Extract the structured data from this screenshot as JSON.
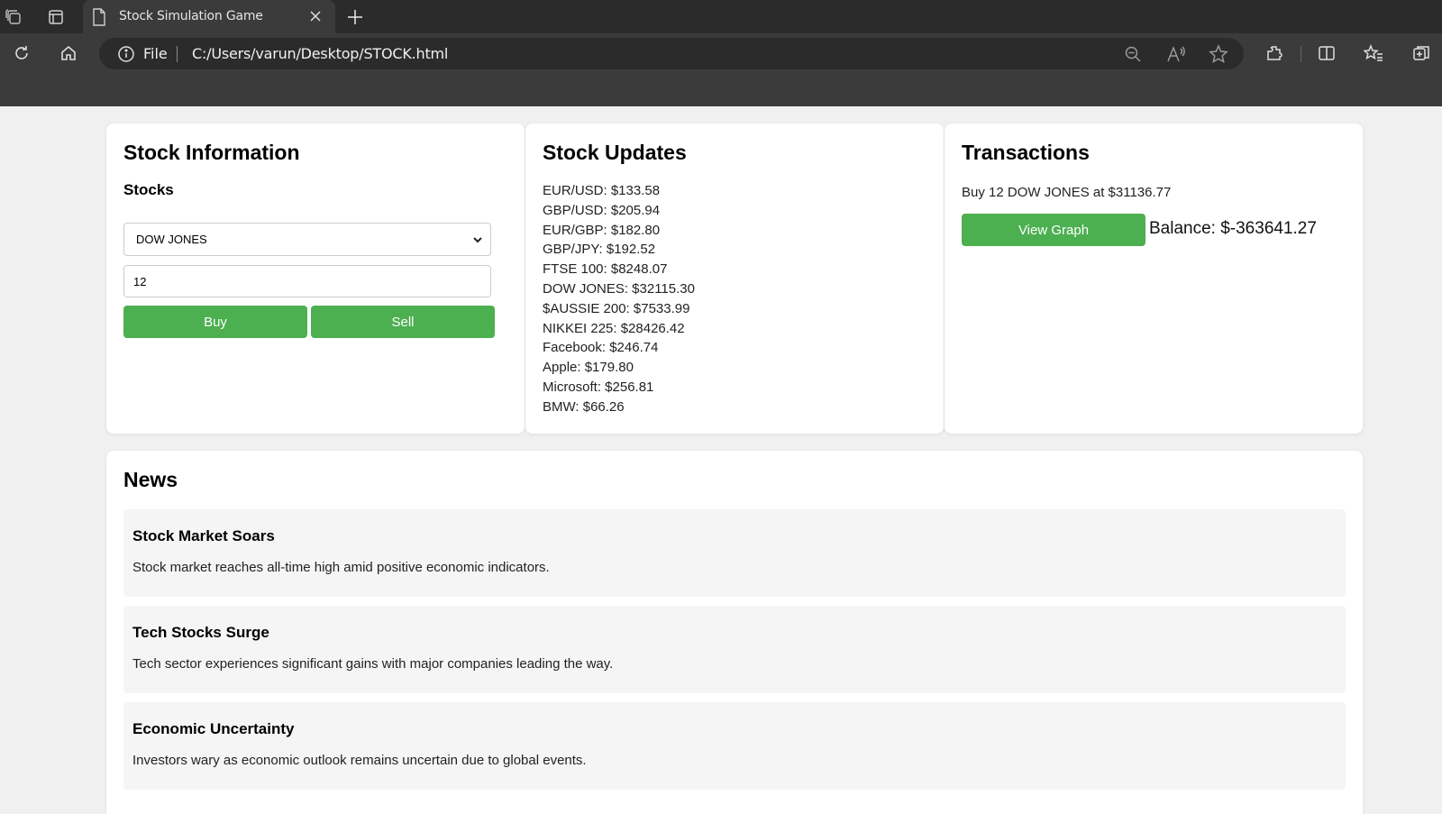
{
  "browser": {
    "tab_title": "Stock Simulation Game",
    "address_scheme": "File",
    "address_url": "C:/Users/varun/Desktop/STOCK.html"
  },
  "stock_info": {
    "title": "Stock Information",
    "stocks_label": "Stocks",
    "selected_stock": "DOW JONES",
    "quantity": "12",
    "buy_label": "Buy",
    "sell_label": "Sell"
  },
  "stock_updates": {
    "title": "Stock Updates",
    "rows": [
      "EUR/USD: $133.58",
      "GBP/USD: $205.94",
      "EUR/GBP: $182.80",
      "GBP/JPY: $192.52",
      "FTSE 100: $8248.07",
      "DOW JONES: $32115.30",
      "$AUSSIE 200: $7533.99",
      "NIKKEI 225: $28426.42",
      "Facebook: $246.74",
      "Apple: $179.80",
      "Microsoft: $256.81",
      "BMW: $66.26"
    ]
  },
  "transactions": {
    "title": "Transactions",
    "last": "Buy 12 DOW JONES at $31136.77",
    "view_graph_label": "View Graph",
    "balance": "Balance: $-363641.27"
  },
  "news": {
    "title": "News",
    "items": [
      {
        "title": "Stock Market Soars",
        "text": "Stock market reaches all-time high amid positive economic indicators."
      },
      {
        "title": "Tech Stocks Surge",
        "text": "Tech sector experiences significant gains with major companies leading the way."
      },
      {
        "title": "Economic Uncertainty",
        "text": "Investors wary as economic outlook remains uncertain due to global events."
      }
    ]
  },
  "colors": {
    "accent_green": "#4caf50",
    "chrome_dark": "#2b2b2b",
    "chrome_mid": "#3b3b3b"
  },
  "icons": [
    "workspaces-icon",
    "tab-actions-icon",
    "page-icon",
    "close-icon",
    "new-tab-icon",
    "refresh-icon",
    "home-icon",
    "info-icon",
    "zoom-out-icon",
    "read-aloud-icon",
    "favorite-star-icon",
    "extensions-icon",
    "split-screen-icon",
    "favorites-icon",
    "collections-icon",
    "chevron-down-icon"
  ]
}
